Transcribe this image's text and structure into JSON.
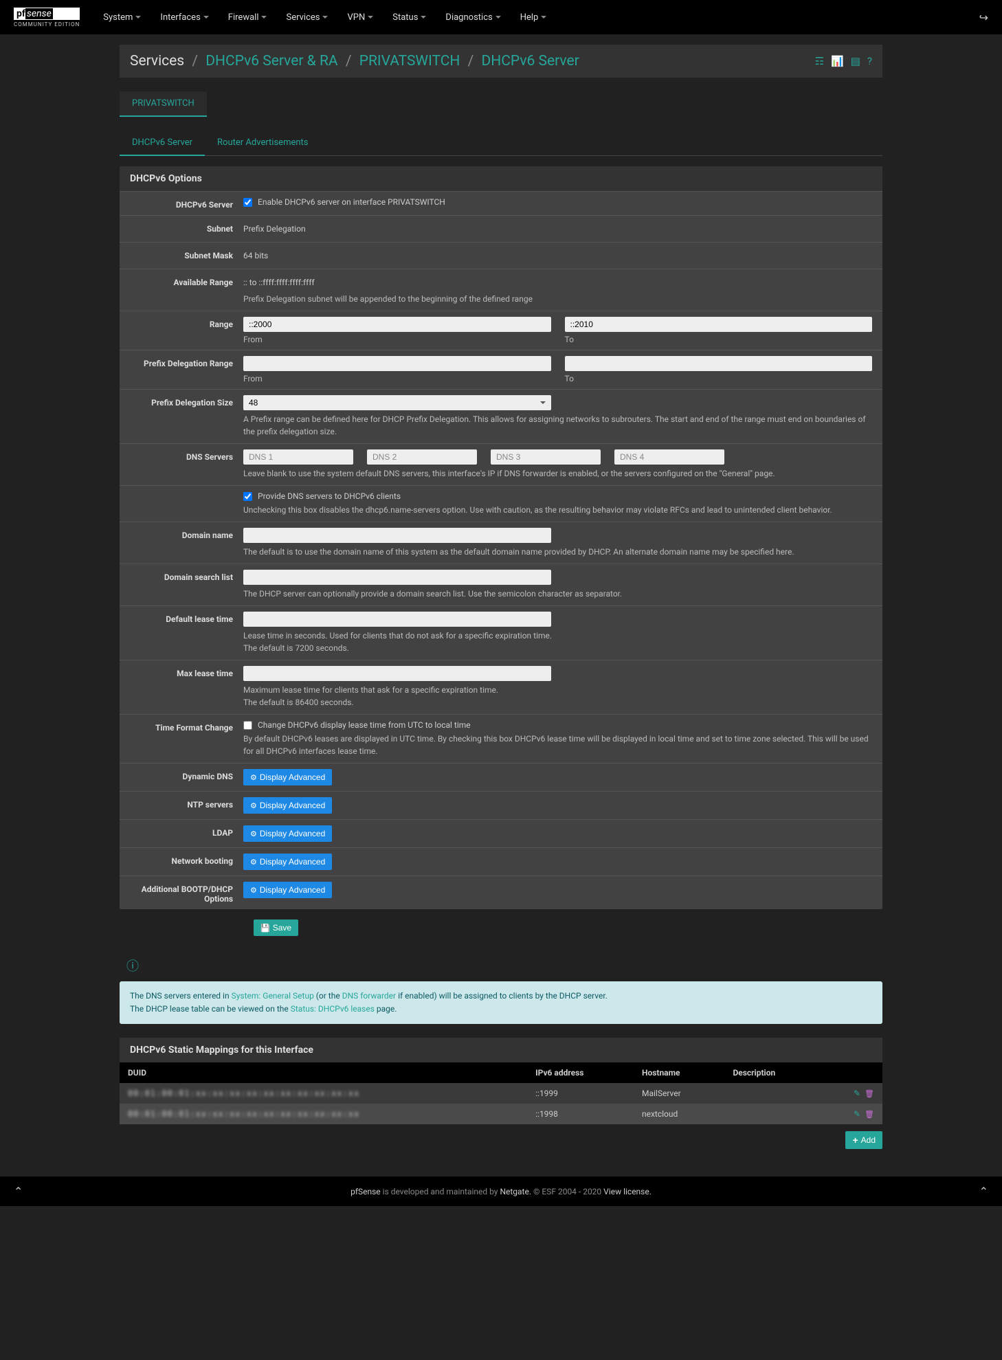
{
  "logo": {
    "pf": "pf",
    "sense": "sense",
    "sub": "COMMUNITY EDITION"
  },
  "nav": [
    "System",
    "Interfaces",
    "Firewall",
    "Services",
    "VPN",
    "Status",
    "Diagnostics",
    "Help"
  ],
  "breadcrumb": {
    "b0": "Services",
    "b1": "DHCPv6 Server & RA",
    "b2": "PRIVATSWITCH",
    "b3": "DHCPv6 Server"
  },
  "interfaceTab": "PRIVATSWITCH",
  "subTabs": {
    "t0": "DHCPv6 Server",
    "t1": "Router Advertisements"
  },
  "panel1Title": "DHCPv6 Options",
  "labels": {
    "dhcpServer": "DHCPv6 Server",
    "subnet": "Subnet",
    "subnetMask": "Subnet Mask",
    "availRange": "Available Range",
    "range": "Range",
    "pdRange": "Prefix Delegation Range",
    "pdSize": "Prefix Delegation Size",
    "dnsServers": "DNS Servers",
    "domainName": "Domain name",
    "domainSearch": "Domain search list",
    "defLease": "Default lease time",
    "maxLease": "Max lease time",
    "timeFormat": "Time Format Change",
    "ddns": "Dynamic DNS",
    "ntp": "NTP servers",
    "ldap": "LDAP",
    "netboot": "Network booting",
    "bootp": "Additional BOOTP/DHCP Options"
  },
  "values": {
    "enableLabel": "Enable DHCPv6 server on interface PRIVATSWITCH",
    "subnet": "Prefix Delegation",
    "subnetMask": "64 bits",
    "availRange": ":: to ::ffff:ffff:ffff:ffff",
    "availRangeHelp": "Prefix Delegation subnet will be appended to the beginning of the defined range",
    "rangeFrom": "::2000",
    "rangeTo": "::2010",
    "fromLabel": "From",
    "toLabel": "To",
    "pdSize": "48",
    "pdHelp": "A Prefix range can be defined here for DHCP Prefix Delegation. This allows for assigning networks to subrouters. The start and end of the range must end on boundaries of the prefix delegation size.",
    "dns1ph": "DNS 1",
    "dns2ph": "DNS 2",
    "dns3ph": "DNS 3",
    "dns4ph": "DNS 4",
    "dnsHelp": "Leave blank to use the system default DNS servers, this interface's IP if DNS forwarder is enabled, or the servers configured on the \"General\" page.",
    "provideDns": "Provide DNS servers to DHCPv6 clients",
    "provideDnsHelp": "Unchecking this box disables the dhcp6.name-servers option. Use with caution, as the resulting behavior may violate RFCs and lead to unintended client behavior.",
    "domainHelp": "The default is to use the domain name of this system as the default domain name provided by DHCP. An alternate domain name may be specified here.",
    "searchHelp": "The DHCP server can optionally provide a domain search list. Use the semicolon character as separator.",
    "defLeaseHelp1": "Lease time in seconds. Used for clients that do not ask for a specific expiration time.",
    "defLeaseHelp2": "The default is 7200 seconds.",
    "maxLeaseHelp1": "Maximum lease time for clients that ask for a specific expiration time.",
    "maxLeaseHelp2": "The default is 86400 seconds.",
    "timeFormatLabel": "Change DHCPv6 display lease time from UTC to local time",
    "timeFormatHelp": "By default DHCPv6 leases are displayed in UTC time. By checking this box DHCPv6 lease time will be displayed in local time and set to time zone selected. This will be used for all DHCPv6 interfaces lease time.",
    "displayAdvanced": "Display Advanced",
    "save": "Save"
  },
  "alert": {
    "l1a": "The DNS servers entered in ",
    "l1link1": "System: General Setup",
    "l1b": " (or the ",
    "l1link2": "DNS forwarder",
    "l1c": " if enabled) will be assigned to clients by the DHCP server.",
    "l2a": "The DHCP lease table can be viewed on the ",
    "l2link": "Status: DHCPv6 leases",
    "l2b": " page."
  },
  "panel2Title": "DHCPv6 Static Mappings for this Interface",
  "tableHeaders": {
    "h0": "DUID",
    "h1": "IPv6 address",
    "h2": "Hostname",
    "h3": "Description"
  },
  "rows": [
    {
      "duid": "00:01:00:01:xx:xx:xx:xx:xx:xx:xx:xx:xx:xx",
      "ip": "::1999",
      "host": "MailServer",
      "desc": ""
    },
    {
      "duid": "00:01:00:01:xx:xx:xx:xx:xx:xx:xx:xx:xx:xx",
      "ip": "::1998",
      "host": "nextcloud",
      "desc": ""
    }
  ],
  "addBtn": "Add",
  "footer": {
    "a": "pfSense",
    "b": " is developed and maintained by ",
    "c": "Netgate.",
    "d": " © ESF 2004 - 2020 ",
    "e": "View license."
  }
}
